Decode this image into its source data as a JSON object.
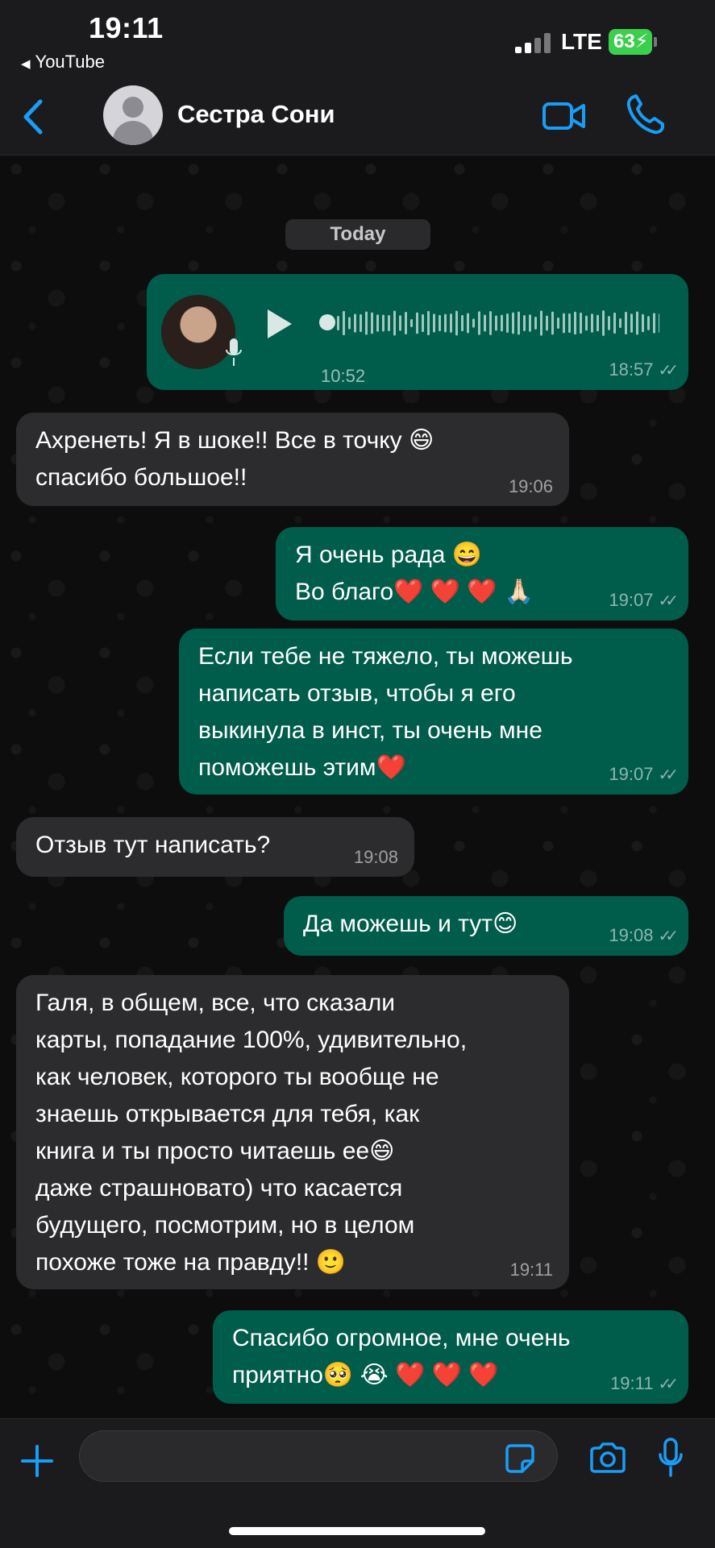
{
  "status_bar": {
    "time": "19:11",
    "back_app": "YouTube",
    "network": "LTE",
    "battery": "63"
  },
  "header": {
    "contact_name": "Сестра Сони"
  },
  "date_separator": "Today",
  "voice_message": {
    "duration": "10:52",
    "time": "18:57"
  },
  "messages": [
    {
      "direction": "incoming",
      "text": "Ахренеть! Я в шоке!! Все в точку 😄\nспасибо большое!!",
      "time": "19:06"
    },
    {
      "direction": "outgoing",
      "text": "Я очень рада 😄\nВо благо❤️ ❤️ ❤️ 🙏🏻",
      "time": "19:07"
    },
    {
      "direction": "outgoing",
      "text": "Если тебе не тяжело, ты можешь\nнаписать отзыв, чтобы я его\nвыкинула в инст, ты очень мне\nпоможешь этим❤️",
      "time": "19:07"
    },
    {
      "direction": "incoming",
      "text": "Отзыв тут написать?",
      "time": "19:08"
    },
    {
      "direction": "outgoing",
      "text": "Да можешь и тут😊",
      "time": "19:08"
    },
    {
      "direction": "incoming",
      "text": "Галя, в общем, все, что сказали\nкарты, попадание 100%, удивительно,\nкак человек, которого ты вообще не\nзнаешь открывается для тебя, как\nкнига и ты просто читаешь ее😄\nдаже страшновато) что касается\nбудущего, посмотрим, но в целом\nпохоже тоже на правду!! 🙂",
      "time": "19:11"
    },
    {
      "direction": "outgoing",
      "text": "Спасибо огромное, мне очень\nприятно🥺 😭 ❤️ ❤️ ❤️",
      "time": "19:11"
    }
  ],
  "icons": {
    "back": "chevron-left-icon",
    "video": "video-camera-icon",
    "call": "phone-icon",
    "plus": "plus-icon",
    "sticker": "sticker-icon",
    "camera": "camera-icon",
    "mic": "microphone-icon"
  },
  "colors": {
    "accent": "#1a9df6",
    "outgoing_bubble": "#005c4b",
    "incoming_bubble": "#2c2c2e",
    "battery": "#3ccf4e"
  }
}
